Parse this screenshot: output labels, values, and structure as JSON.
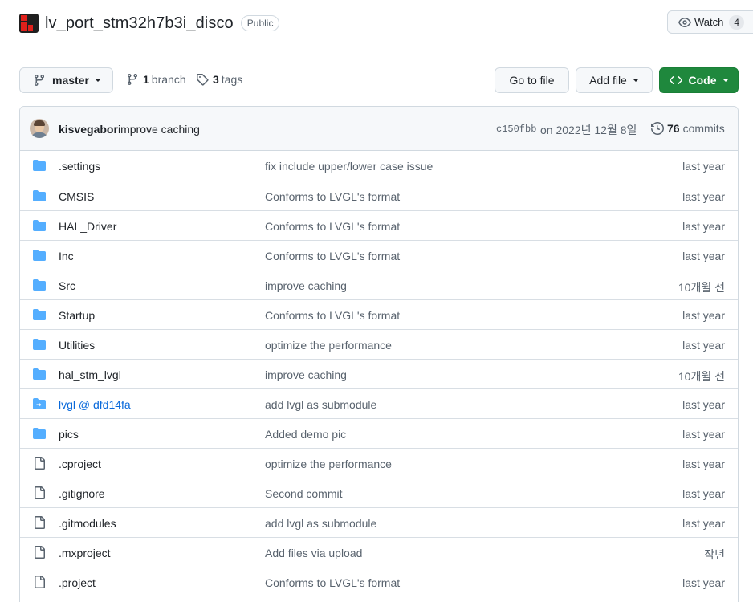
{
  "repo": {
    "name": "lv_port_stm32h7b3i_disco",
    "visibility": "Public",
    "watch_label": "Watch",
    "watch_count": "4"
  },
  "toolbar": {
    "branch_name": "master",
    "branch_count": "1",
    "branch_label": "branch",
    "tag_count": "3",
    "tag_label": "tags",
    "goto_file": "Go to file",
    "add_file": "Add file",
    "code": "Code"
  },
  "latest_commit": {
    "author": "kisvegabor",
    "message": "improve caching",
    "sha": "c150fbb",
    "date": "on 2022년 12월 8일",
    "commit_count": "76",
    "commit_label": "commits"
  },
  "files": [
    {
      "name": ".settings",
      "message": "fix include upper/lower case issue",
      "age": "last year",
      "type": "folder"
    },
    {
      "name": "CMSIS",
      "message": "Conforms to LVGL's format",
      "age": "last year",
      "type": "folder"
    },
    {
      "name": "HAL_Driver",
      "message": "Conforms to LVGL's format",
      "age": "last year",
      "type": "folder"
    },
    {
      "name": "Inc",
      "message": "Conforms to LVGL's format",
      "age": "last year",
      "type": "folder"
    },
    {
      "name": "Src",
      "message": "improve caching",
      "age": "10개월 전",
      "type": "folder"
    },
    {
      "name": "Startup",
      "message": "Conforms to LVGL's format",
      "age": "last year",
      "type": "folder"
    },
    {
      "name": "Utilities",
      "message": "optimize the performance",
      "age": "last year",
      "type": "folder"
    },
    {
      "name": "hal_stm_lvgl",
      "message": "improve caching",
      "age": "10개월 전",
      "type": "folder"
    },
    {
      "name": "lvgl @ dfd14fa",
      "message": "add lvgl as submodule",
      "age": "last year",
      "type": "submodule"
    },
    {
      "name": "pics",
      "message": "Added demo pic",
      "age": "last year",
      "type": "folder"
    },
    {
      "name": ".cproject",
      "message": "optimize the performance",
      "age": "last year",
      "type": "file"
    },
    {
      "name": ".gitignore",
      "message": "Second commit",
      "age": "last year",
      "type": "file"
    },
    {
      "name": ".gitmodules",
      "message": "add lvgl as submodule",
      "age": "last year",
      "type": "file"
    },
    {
      "name": ".mxproject",
      "message": "Add files via upload",
      "age": "작년",
      "type": "file"
    },
    {
      "name": ".project",
      "message": "Conforms to LVGL's format",
      "age": "last year",
      "type": "file"
    }
  ],
  "colors": {
    "folder": "#54aeff",
    "file_icon": "#59636e",
    "link": "#0969da",
    "primary_button": "#1f883d"
  }
}
